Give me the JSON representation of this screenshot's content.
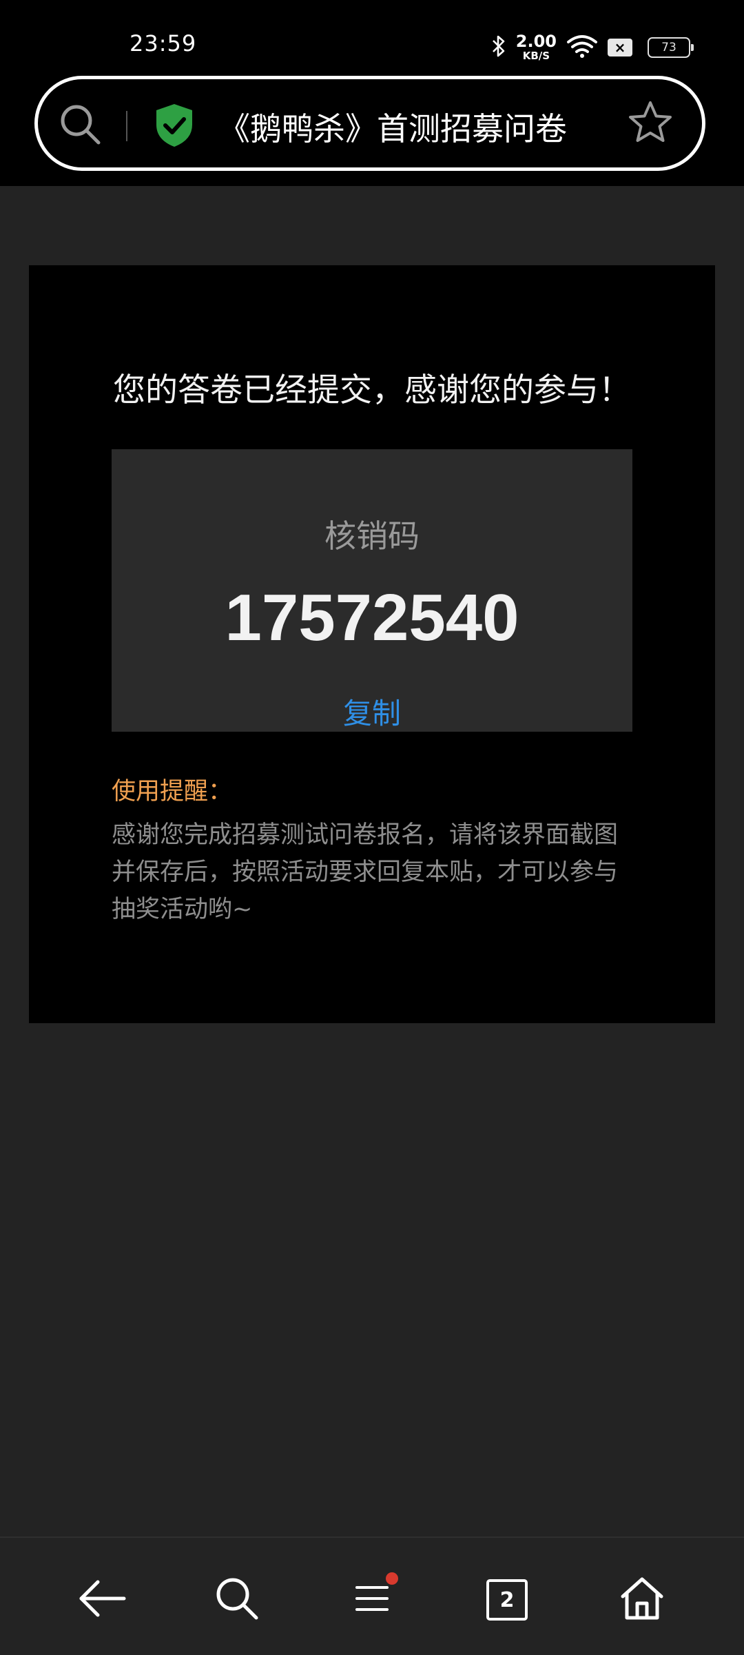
{
  "status_bar": {
    "time": "23:59",
    "net_speed_value": "2.00",
    "net_speed_unit": "KB/S",
    "sim_badge": "×",
    "battery": "73",
    "icons": [
      "bluetooth-icon",
      "wifi-icon",
      "sim-off-icon",
      "battery-icon"
    ]
  },
  "address_bar": {
    "title": "《鹅鸭杀》首测招募问卷",
    "secure_icon": "shield-check-icon",
    "accent_color": "#2ea043"
  },
  "card": {
    "headline": "您的答卷已经提交，感谢您的参与！",
    "code_label": "核销码",
    "code_value": "17572540",
    "copy_label": "复制",
    "reminder_title": "使用提醒：",
    "reminder_body": "感谢您完成招募测试问卷报名，请将该界面截图并保存后，按照活动要求回复本贴，才可以参与抽奖活动哟~"
  },
  "bottom_nav": {
    "tab_count": "2",
    "items": [
      "back-icon",
      "search-icon",
      "menu-icon",
      "tabs-icon",
      "home-icon"
    ]
  }
}
